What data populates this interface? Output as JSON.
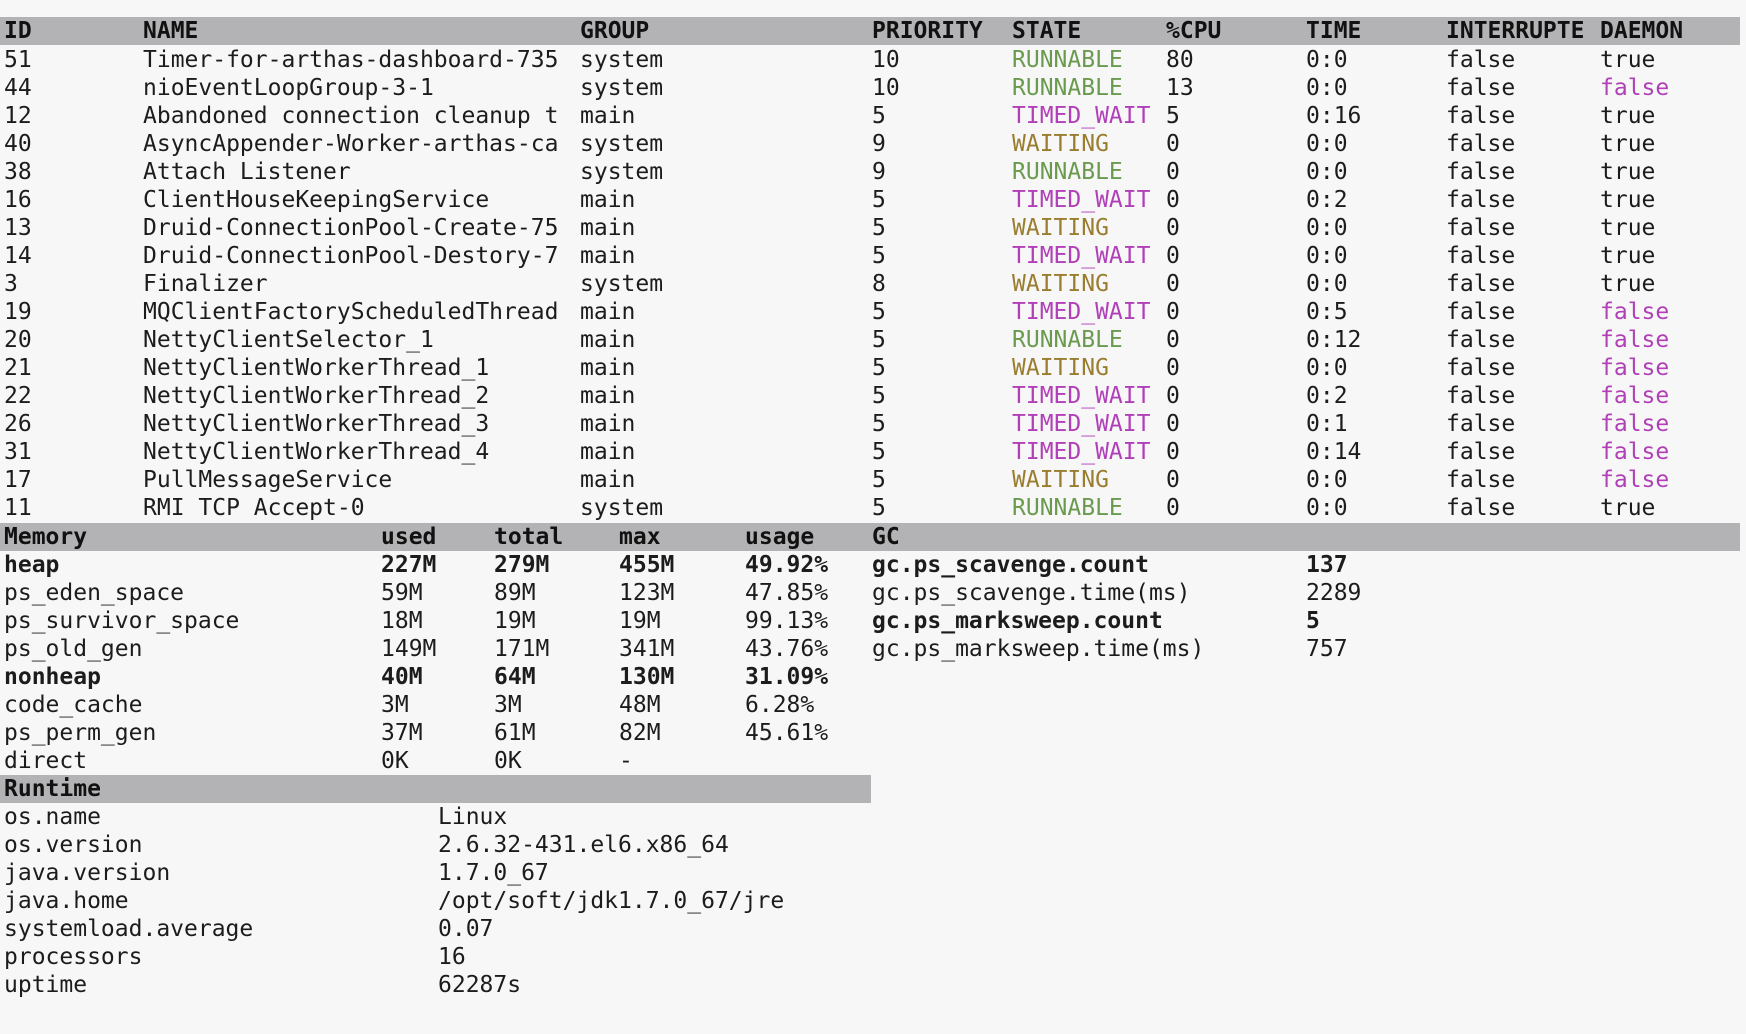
{
  "threads": {
    "headers": [
      "ID",
      "NAME",
      "GROUP",
      "PRIORITY",
      "STATE",
      "%CPU",
      "TIME",
      "INTERRUPTE",
      "DAEMON"
    ],
    "rows": [
      [
        "51",
        "Timer-for-arthas-dashboard-735",
        "system",
        "10",
        "RUNNABLE",
        "80",
        "0:0",
        "false",
        "true"
      ],
      [
        "44",
        "nioEventLoopGroup-3-1",
        "system",
        "10",
        "RUNNABLE",
        "13",
        "0:0",
        "false",
        "false"
      ],
      [
        "12",
        "Abandoned connection cleanup t",
        "main",
        "5",
        "TIMED_WAIT",
        "5",
        "0:16",
        "false",
        "true"
      ],
      [
        "40",
        "AsyncAppender-Worker-arthas-ca",
        "system",
        "9",
        "WAITING",
        "0",
        "0:0",
        "false",
        "true"
      ],
      [
        "38",
        "Attach Listener",
        "system",
        "9",
        "RUNNABLE",
        "0",
        "0:0",
        "false",
        "true"
      ],
      [
        "16",
        "ClientHouseKeepingService",
        "main",
        "5",
        "TIMED_WAIT",
        "0",
        "0:2",
        "false",
        "true"
      ],
      [
        "13",
        "Druid-ConnectionPool-Create-75",
        "main",
        "5",
        "WAITING",
        "0",
        "0:0",
        "false",
        "true"
      ],
      [
        "14",
        "Druid-ConnectionPool-Destory-7",
        "main",
        "5",
        "TIMED_WAIT",
        "0",
        "0:0",
        "false",
        "true"
      ],
      [
        "3",
        "Finalizer",
        "system",
        "8",
        "WAITING",
        "0",
        "0:0",
        "false",
        "true"
      ],
      [
        "19",
        "MQClientFactoryScheduledThread",
        "main",
        "5",
        "TIMED_WAIT",
        "0",
        "0:5",
        "false",
        "false"
      ],
      [
        "20",
        "NettyClientSelector_1",
        "main",
        "5",
        "RUNNABLE",
        "0",
        "0:12",
        "false",
        "false"
      ],
      [
        "21",
        "NettyClientWorkerThread_1",
        "main",
        "5",
        "WAITING",
        "0",
        "0:0",
        "false",
        "false"
      ],
      [
        "22",
        "NettyClientWorkerThread_2",
        "main",
        "5",
        "TIMED_WAIT",
        "0",
        "0:2",
        "false",
        "false"
      ],
      [
        "26",
        "NettyClientWorkerThread_3",
        "main",
        "5",
        "TIMED_WAIT",
        "0",
        "0:1",
        "false",
        "false"
      ],
      [
        "31",
        "NettyClientWorkerThread_4",
        "main",
        "5",
        "TIMED_WAIT",
        "0",
        "0:14",
        "false",
        "false"
      ],
      [
        "17",
        "PullMessageService",
        "main",
        "5",
        "WAITING",
        "0",
        "0:0",
        "false",
        "false"
      ],
      [
        "11",
        "RMI TCP Accept-0",
        "system",
        "5",
        "RUNNABLE",
        "0",
        "0:0",
        "false",
        "true"
      ]
    ]
  },
  "memory": {
    "headers": [
      "Memory",
      "used",
      "total",
      "max",
      "usage"
    ],
    "rows": [
      {
        "cells": [
          "heap",
          "227M",
          "279M",
          "455M",
          "49.92%"
        ],
        "bold": true
      },
      {
        "cells": [
          "ps_eden_space",
          "59M",
          "89M",
          "123M",
          "47.85%"
        ],
        "bold": false
      },
      {
        "cells": [
          "ps_survivor_space",
          "18M",
          "19M",
          "19M",
          "99.13%"
        ],
        "bold": false
      },
      {
        "cells": [
          "ps_old_gen",
          "149M",
          "171M",
          "341M",
          "43.76%"
        ],
        "bold": false
      },
      {
        "cells": [
          "nonheap",
          "40M",
          "64M",
          "130M",
          "31.09%"
        ],
        "bold": true
      },
      {
        "cells": [
          "code_cache",
          "3M",
          "3M",
          "48M",
          "6.28%"
        ],
        "bold": false
      },
      {
        "cells": [
          "ps_perm_gen",
          "37M",
          "61M",
          "82M",
          "45.61%"
        ],
        "bold": false
      },
      {
        "cells": [
          "direct",
          "0K",
          "0K",
          "-",
          ""
        ],
        "bold": false
      }
    ]
  },
  "gc": {
    "header": "GC",
    "rows": [
      {
        "cells": [
          "gc.ps_scavenge.count",
          "137"
        ],
        "bold": true
      },
      {
        "cells": [
          "gc.ps_scavenge.time(ms)",
          "2289"
        ],
        "bold": false
      },
      {
        "cells": [
          "gc.ps_marksweep.count",
          "5"
        ],
        "bold": true
      },
      {
        "cells": [
          "gc.ps_marksweep.time(ms)",
          "757"
        ],
        "bold": false
      }
    ]
  },
  "runtime": {
    "header": "Runtime",
    "rows": [
      [
        "os.name",
        "Linux"
      ],
      [
        "os.version",
        "2.6.32-431.el6.x86_64"
      ],
      [
        "java.version",
        "1.7.0_67"
      ],
      [
        "java.home",
        "/opt/soft/jdk1.7.0_67/jre"
      ],
      [
        "systemload.average",
        "0.07"
      ],
      [
        "processors",
        "16"
      ],
      [
        "uptime",
        "62287s"
      ]
    ]
  },
  "colors": {
    "header_bg": "#b3b3b6",
    "runnable": "#6a9a4e",
    "waiting": "#9a7d2e",
    "timed_wait": "#b13fb8",
    "daemon_false": "#b13fb8",
    "text": "#1c1c1c"
  }
}
